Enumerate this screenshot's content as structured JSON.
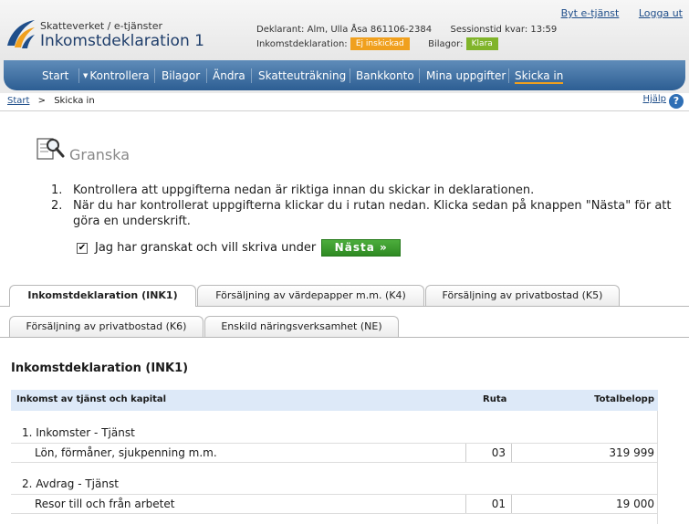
{
  "header": {
    "subtitle": "Skatteverket / e-tjänster",
    "title": "Inkomstdeklaration 1",
    "links": [
      "Byt e-tjänst",
      "Logga ut"
    ],
    "declarant_label": "Deklarant:",
    "declarant_value": "Alm, Ulla Åsa 861106-2384",
    "session_label": "Sessionstid kvar:",
    "session_value": "13:59",
    "ink_label": "Inkomstdeklaration:",
    "ink_status": "Ej inskickad",
    "ink_status_color": "#f0a01e",
    "attachments_label": "Bilagor:",
    "attachments_status": "Klara",
    "attachments_status_color": "#80b42a"
  },
  "nav": {
    "items": [
      "Start",
      "Kontrollera",
      "Bilagor",
      "Ändra",
      "Skatteuträkning",
      "Bankkonto",
      "Mina uppgifter",
      "Skicka in"
    ],
    "active": "Skicka in"
  },
  "breadcrumb": {
    "home": "Start",
    "sep": ">",
    "current": "Skicka in"
  },
  "help": {
    "label": "Hjälp",
    "icon": "?"
  },
  "granska": {
    "title": "Granska",
    "steps": [
      {
        "num": "1.",
        "text": "Kontrollera att uppgifterna nedan är riktiga innan du skickar in deklarationen."
      },
      {
        "num": "2.",
        "text": "När du har kontrollerat uppgifterna klickar du i rutan nedan. Klicka sedan på knappen \"Nästa\" för att göra en underskrift."
      }
    ],
    "checkbox_label": "Jag har granskat och vill skriva under",
    "checkbox_checked": true,
    "next_button": "Nästa »"
  },
  "tabs": {
    "row1": [
      "Inkomstdeklaration (INK1)",
      "Försäljning av värdepapper m.m. (K4)",
      "Försäljning av privatbostad (K5)"
    ],
    "row2": [
      "Försäljning av privatbostad (K6)",
      "Enskild näringsverksamhet (NE)"
    ],
    "active": "Inkomstdeklaration (INK1)"
  },
  "section": {
    "title": "Inkomstdeklaration (INK1)",
    "columns": [
      "Inkomst av tjänst och kapital",
      "Ruta",
      "Totalbelopp"
    ],
    "groups": [
      {
        "heading": "1. Inkomster - Tjänst",
        "rows": [
          {
            "label": "Lön, förmåner, sjukpenning m.m.",
            "box": "03",
            "amount": "319 999"
          }
        ]
      },
      {
        "heading": "2. Avdrag - Tjänst",
        "rows": [
          {
            "label": "Resor till och från arbetet",
            "box": "01",
            "amount": "19 000"
          }
        ]
      }
    ]
  }
}
